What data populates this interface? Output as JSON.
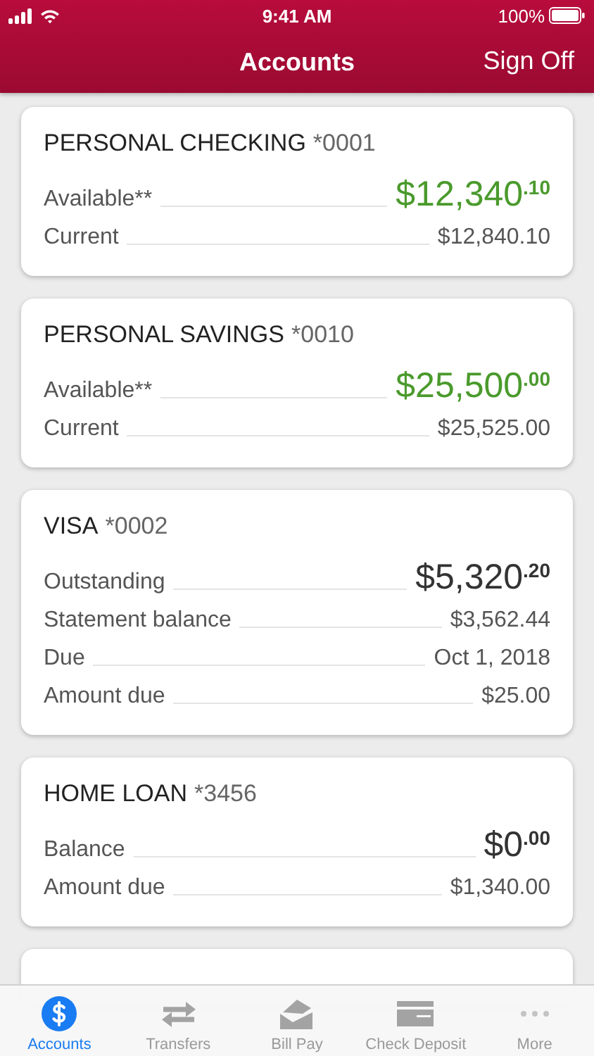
{
  "status_bar": {
    "time": "9:41 AM",
    "battery": "100%"
  },
  "nav_bar": {
    "title": "Accounts",
    "action": "Sign Off"
  },
  "accounts": [
    {
      "name": "PERSONAL CHECKING",
      "number": "*0001",
      "rows": [
        {
          "kind": "big",
          "label": "Available**",
          "amount": "$12,340$^{.10}$",
          "color": "#4a9a2c"
        },
        {
          "kind": "small",
          "label": "Current",
          "amount": "$12,840.10"
        }
      ]
    },
    {
      "name": "PERSONAL SAVINGS",
      "number": "*0010",
      "rows": [
        {
          "kind": "big",
          "label": "Available**",
          "amount": "$25,500$^{.00}$",
          "color": "#4a9a2c"
        },
        {
          "kind": "small",
          "label": "Current",
          "amount": "$25,525.00"
        }
      ]
    },
    {
      "name": "VISA",
      "number": "*0002",
      "rows": [
        {
          "kind": "big",
          "label": "Outstanding",
          "amount": "$5,320$^{.20}$",
          "color": "#333333"
        },
        {
          "kind": "small",
          "label": "Statement balance",
          "amount": "$3,562.44"
        },
        {
          "kind": "small",
          "label": "Due",
          "amount": "Oct 1, 2018"
        },
        {
          "kind": "small",
          "label": "Amount due",
          "amount": "$25.00"
        }
      ]
    },
    {
      "name": "HOME LOAN",
      "number": "*3456",
      "rows": [
        {
          "kind": "big",
          "label": "Balance",
          "amount": "$0$^{.00}$",
          "color": "#333333"
        },
        {
          "kind": "small",
          "label": "Amount due",
          "amount": "$1,340.00"
        }
      ]
    }
  ],
  "tab_bar": [
    {
      "label": "Accounts",
      "selected": true
    },
    {
      "label": "Transfers",
      "selected": false
    },
    {
      "label": "Bill Pay",
      "selected": false
    },
    {
      "label": "Check Deposit",
      "selected": false
    },
    {
      "label": "More",
      "selected": false
    }
  ]
}
